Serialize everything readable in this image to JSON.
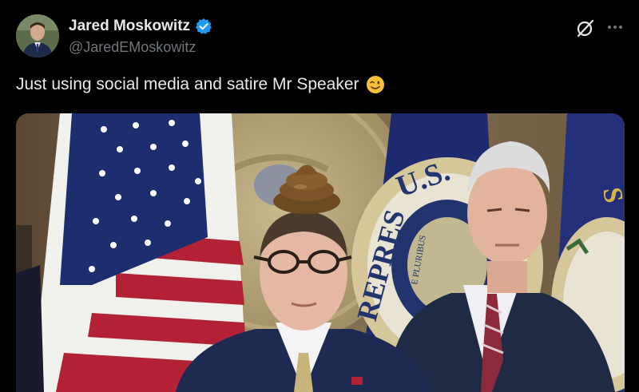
{
  "author": {
    "display_name": "Jared Moskowitz",
    "handle": "@JaredEMoskowitz",
    "verified": true,
    "verified_color": "#1d9bf0"
  },
  "actions": {
    "grok_icon": "grok-icon",
    "more_icon": "more-options-icon"
  },
  "tweet": {
    "text": "Just using social media and satire Mr Speaker",
    "emoji": "winking-face-emoji"
  },
  "media": {
    "type": "photo",
    "seal_text": "U.S. HOUSE OF REPRESENTATIVES",
    "flag_text": "E PLURIBUS"
  },
  "colors": {
    "background": "#000000",
    "text_primary": "#e7e9ea",
    "text_secondary": "#71767b"
  }
}
